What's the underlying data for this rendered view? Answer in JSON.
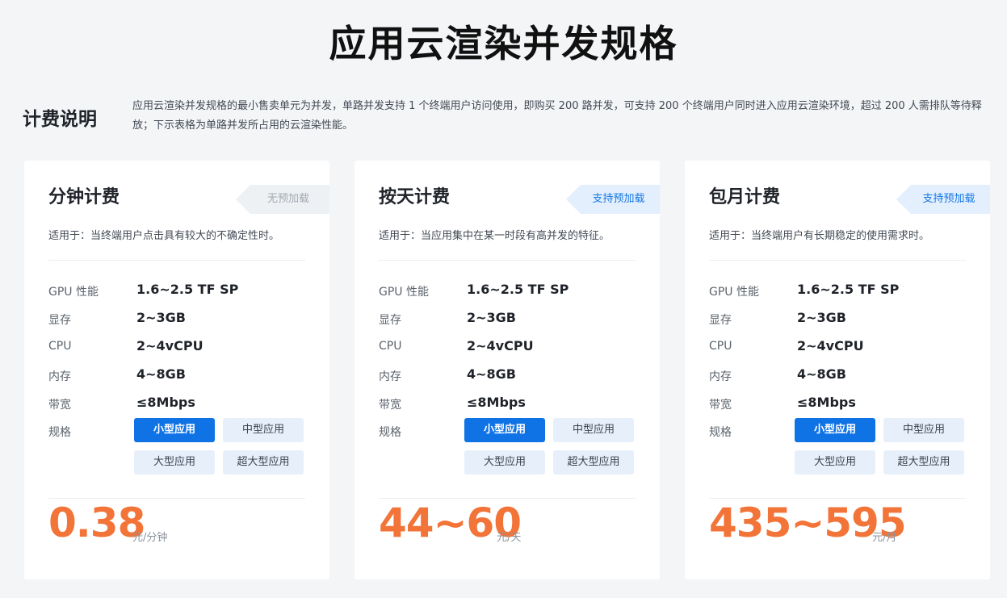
{
  "page": {
    "title": "应用云渲染并发规格"
  },
  "billing_note": {
    "label": "计费说明",
    "description": "应用云渲染并发规格的最小售卖单元为并发，单路并发支持 1 个终端用户访问使用，即购买 200 路并发，可支持 200 个终端用户同时进入应用云渲染环境，超过 200 人需排队等待释放；下示表格为单路并发所占用的云渲染性能。"
  },
  "spec_labels": {
    "gpu": "GPU 性能",
    "memory": "显存",
    "cpu": "CPU",
    "ram": "内存",
    "bandwidth": "带宽",
    "size": "规格"
  },
  "size_options": [
    "小型应用",
    "中型应用",
    "大型应用",
    "超大型应用"
  ],
  "cards": [
    {
      "title": "分钟计费",
      "preload_tag": "无预加载",
      "preload_supported": false,
      "usage": "适用于：当终端用户点击具有较大的不确定性时。",
      "specs": {
        "gpu": "1.6~2.5 TF SP",
        "memory": "2~3GB",
        "cpu": "2~4vCPU",
        "ram": "4~8GB",
        "bandwidth": "≤8Mbps"
      },
      "selected_size": "小型应用",
      "price": "0.38",
      "unit": "元/分钟"
    },
    {
      "title": "按天计费",
      "preload_tag": "支持预加载",
      "preload_supported": true,
      "usage": "适用于：当应用集中在某一时段有高并发的特征。",
      "specs": {
        "gpu": "1.6~2.5 TF SP",
        "memory": "2~3GB",
        "cpu": "2~4vCPU",
        "ram": "4~8GB",
        "bandwidth": "≤8Mbps"
      },
      "selected_size": "小型应用",
      "price": "44~60",
      "unit": "元/天"
    },
    {
      "title": "包月计费",
      "preload_tag": "支持预加载",
      "preload_supported": true,
      "usage": "适用于：当终端用户有长期稳定的使用需求时。",
      "specs": {
        "gpu": "1.6~2.5 TF SP",
        "memory": "2~3GB",
        "cpu": "2~4vCPU",
        "ram": "4~8GB",
        "bandwidth": "≤8Mbps"
      },
      "selected_size": "小型应用",
      "price": "435~595",
      "unit": "元/月"
    }
  ],
  "colors": {
    "accent_blue": "#0f73e6",
    "price_orange": "#f27438",
    "background": "#f3f5f7"
  }
}
